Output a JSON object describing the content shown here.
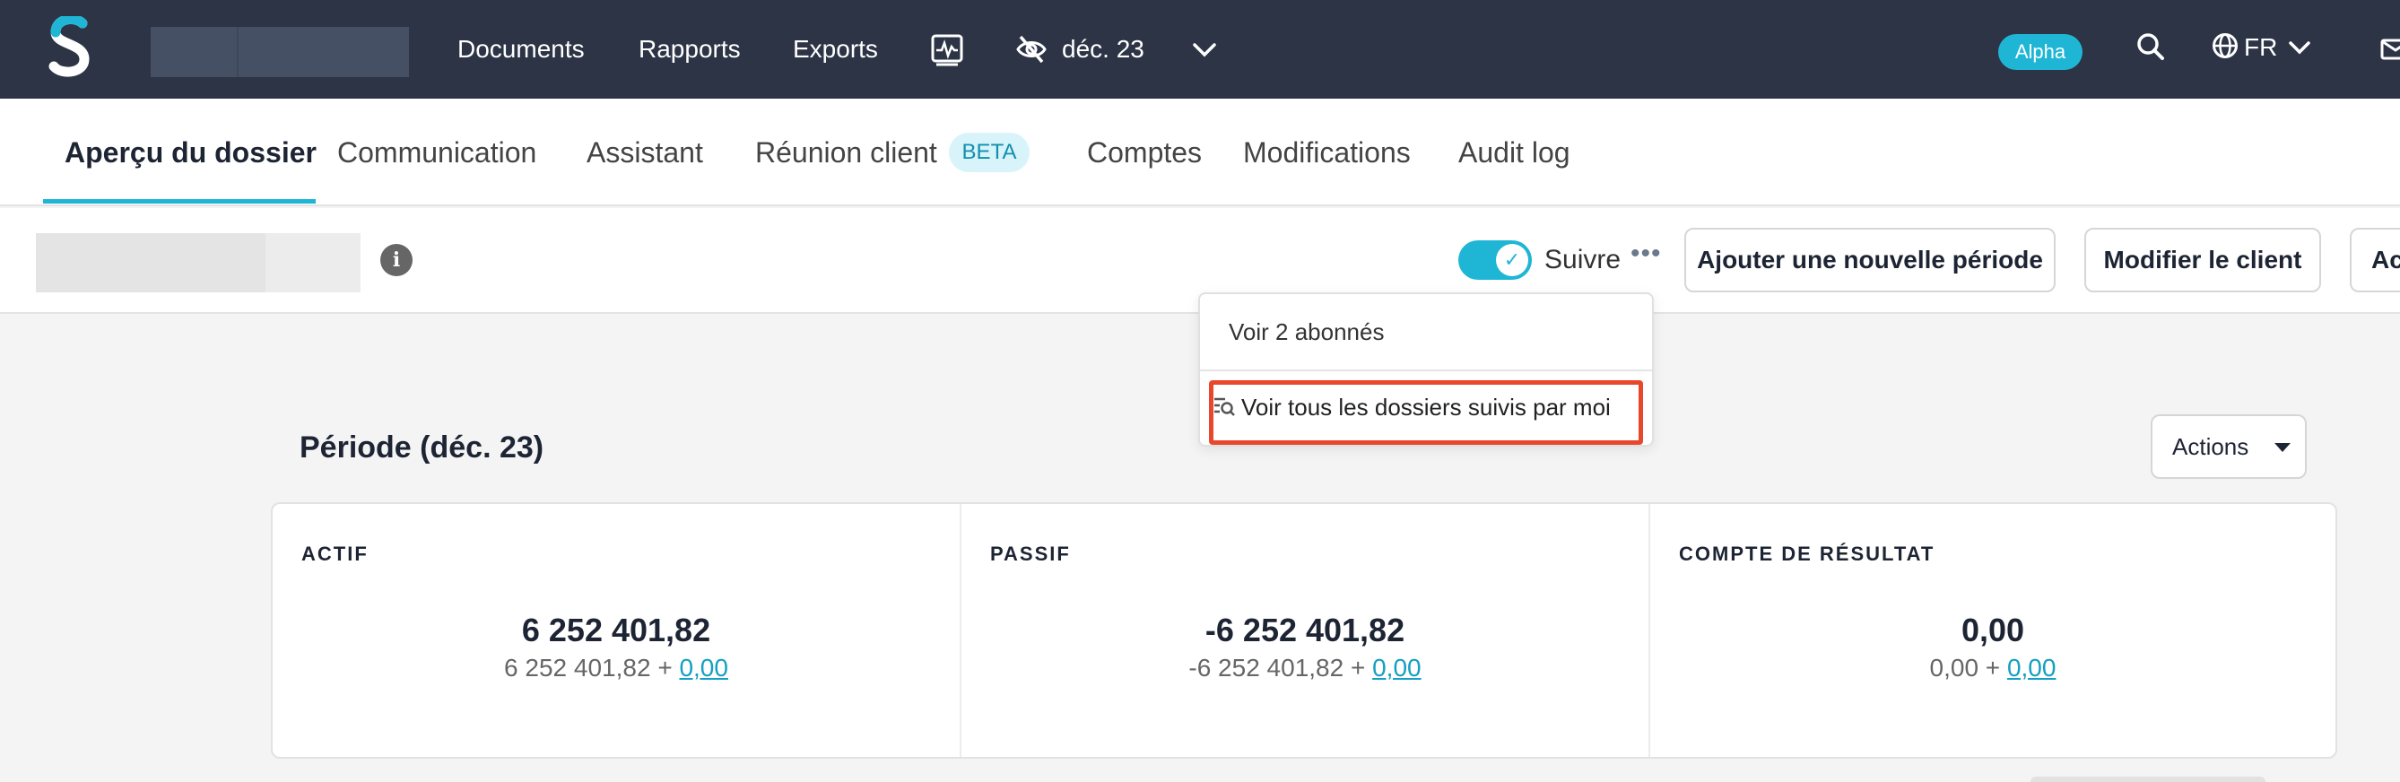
{
  "topnav": {
    "links": [
      "Documents",
      "Rapports",
      "Exports"
    ],
    "period": "déc. 23",
    "badge": "Alpha",
    "language": "FR",
    "colors": {
      "background": "#2c3446",
      "accent": "#1fb6d6"
    }
  },
  "tabs": {
    "items": [
      "Aperçu du dossier",
      "Communication",
      "Assistant",
      "Réunion client",
      "Comptes",
      "Modifications",
      "Audit log"
    ],
    "active": "Aperçu du dossier",
    "beta_badge": "BETA"
  },
  "subheader": {
    "follow_label": "Suivre",
    "follow_enabled": true,
    "buttons": [
      "Ajouter une nouvelle période",
      "Modifier le client",
      "Ac"
    ]
  },
  "dropdown": {
    "items": [
      "Voir 2 abonnés",
      "Voir tous les dossiers suivis par moi"
    ],
    "highlight_color": "#e8472c"
  },
  "main": {
    "period_title": "Période (déc. 23)",
    "actions_label": "Actions",
    "columns": [
      {
        "label": "ACTIF",
        "value": "6 252 401,82",
        "sub_prefix": "6 252 401,82 +",
        "sub_link": "0,00"
      },
      {
        "label": "PASSIF",
        "value": "-6 252 401,82",
        "sub_prefix": "-6 252 401,82 +",
        "sub_link": "0,00"
      },
      {
        "label": "COMPTE DE RÉSULTAT",
        "value": "0,00",
        "sub_prefix": "0,00 +",
        "sub_link": "0,00"
      }
    ]
  }
}
